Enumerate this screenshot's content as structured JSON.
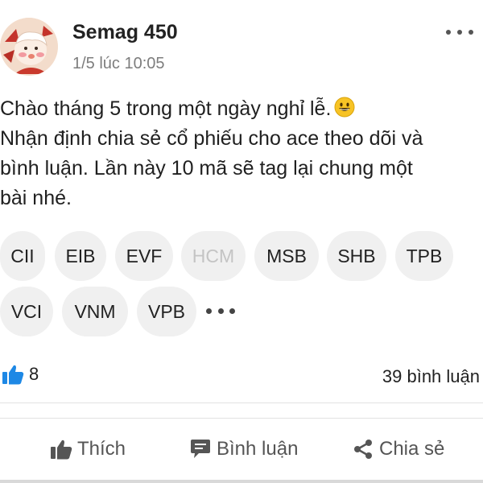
{
  "post": {
    "author": "Semag 450",
    "timestamp": "1/5 lúc 10:05",
    "content_lines": [
      "Chào tháng 5 trong một ngày nghỉ lễ.",
      "Nhận định chia sẻ cổ phiếu cho ace theo dõi và",
      "bình luận. Lần này 10 mã sẽ tag lại chung một",
      "bài nhé."
    ],
    "emoji": "grinning-face-emoji"
  },
  "tags": {
    "row1": [
      "CII",
      "EIB",
      "EVF",
      "HCM",
      "MSB",
      "SHB",
      "TPB"
    ],
    "row2": [
      "VCI",
      "VNM",
      "VPB"
    ],
    "disabled_tag": "HCM"
  },
  "stats": {
    "likes": "8",
    "comments": "39 bình luận"
  },
  "actions": {
    "like": "Thích",
    "comment": "Bình luận",
    "share": "Chia sẻ"
  },
  "icons": {
    "more": "more-horizontal-icon",
    "like": "thumbs-up-icon",
    "comment": "comment-bubble-icon",
    "share": "share-icon"
  },
  "colors": {
    "like_blue": "#1e88e5",
    "tag_bg": "#f0f0f0",
    "muted_text": "#7d7d7d"
  }
}
